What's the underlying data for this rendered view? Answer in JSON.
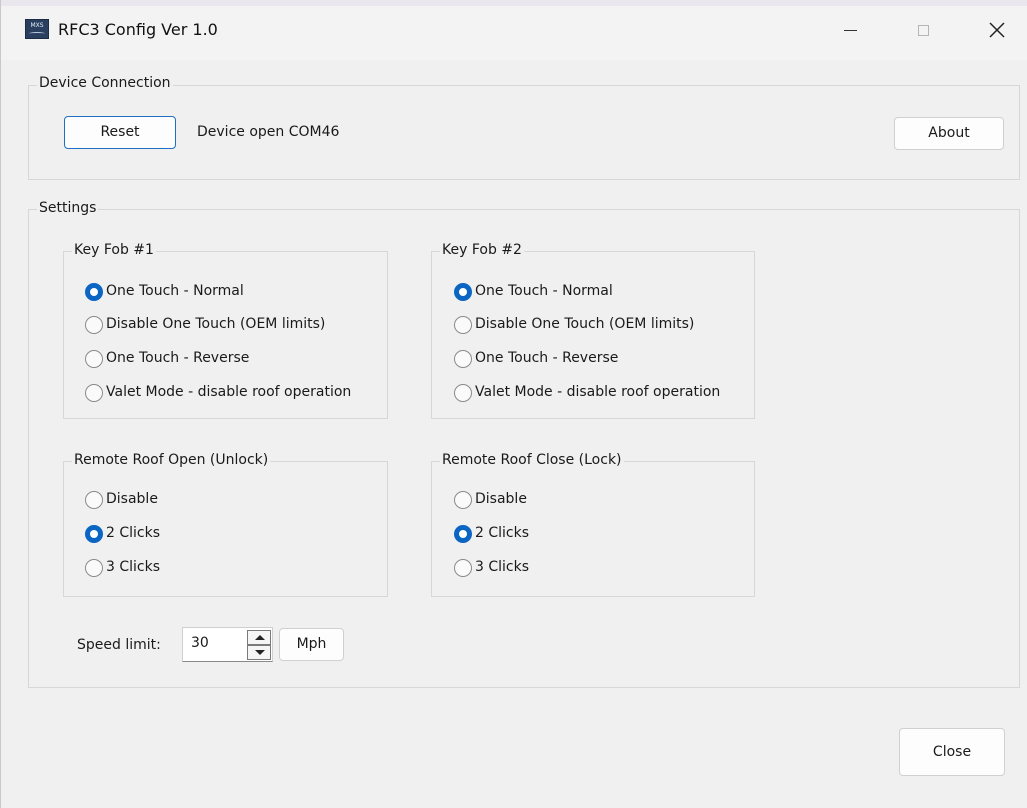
{
  "window": {
    "title": "RFC3 Config Ver 1.0",
    "icon_text": "MXS",
    "icon": "app-logo-icon",
    "controls": [
      "minimize-icon",
      "maximize-icon",
      "close-icon"
    ]
  },
  "device_connection": {
    "legend": "Device Connection",
    "reset_label": "Reset",
    "status": "Device open COM46",
    "about_label": "About"
  },
  "settings": {
    "legend": "Settings",
    "key_fob_1": {
      "legend": "Key Fob #1",
      "options": [
        "One Touch - Normal",
        "Disable One Touch (OEM limits)",
        "One Touch - Reverse",
        "Valet Mode - disable roof operation"
      ],
      "selected": "One Touch - Normal"
    },
    "key_fob_2": {
      "legend": "Key Fob #2",
      "options": [
        "One Touch - Normal",
        "Disable One Touch (OEM limits)",
        "One Touch - Reverse",
        "Valet Mode - disable roof operation"
      ],
      "selected": "One Touch - Normal"
    },
    "remote_open": {
      "legend": "Remote Roof Open (Unlock)",
      "options": [
        "Disable",
        "2 Clicks",
        "3 Clicks"
      ],
      "selected": "2 Clicks"
    },
    "remote_close": {
      "legend": "Remote Roof Close (Lock)",
      "options": [
        "Disable",
        "2 Clicks",
        "3 Clicks"
      ],
      "selected": "2 Clicks"
    },
    "speed": {
      "label": "Speed limit:",
      "value": "30",
      "unit_label": "Mph"
    }
  },
  "footer": {
    "close_label": "Close"
  },
  "colors": {
    "accent": "#0a66c2",
    "window_bg": "#f0f0f0"
  }
}
